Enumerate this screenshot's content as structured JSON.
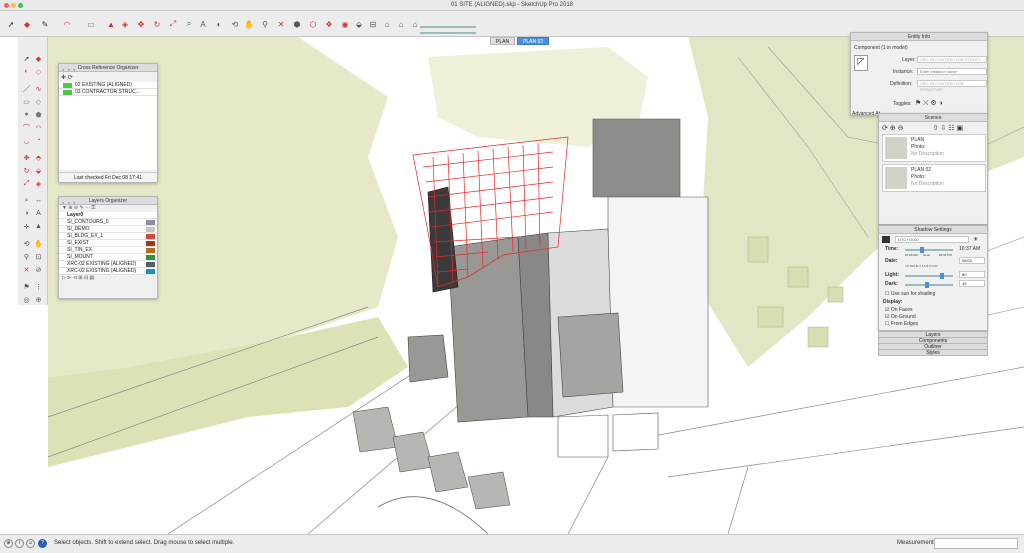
{
  "window": {
    "title": "01 SITE (ALIGNED).skp - SketchUp Pro 2018"
  },
  "colors": {
    "selection": "#e8272a",
    "terrain": "#dfe3b8",
    "building_dark": "#8a8886",
    "accent": "#4a90d9"
  },
  "scene_tabs": [
    {
      "label": "PLAN",
      "active": false
    },
    {
      "label": "PLAN 02",
      "active": true
    }
  ],
  "toolbar": {
    "shadow_time_start": "06:30",
    "shadow_time_end": "10:37 AM"
  },
  "xref_organizer": {
    "title": "Cross Reference Organizer",
    "items": [
      {
        "label": "02 EXISTING (ALIGNED)",
        "color": "#4fc84a"
      },
      {
        "label": "03 CONTRACTOR STRUC...",
        "color": "#4fc84a"
      }
    ],
    "footer": "Last checked Fri Dec 08 17:41"
  },
  "layers_organizer": {
    "title": "Layers Organizer",
    "header": "Layer0",
    "layers": [
      {
        "name": "SI_CONTOURS_0",
        "color": "#8a8f9c"
      },
      {
        "name": "SI_DEMO",
        "color": "#c6c6c6"
      },
      {
        "name": "SI_BLDG_EX_1",
        "color": "#d8453f"
      },
      {
        "name": "SI_EXIST",
        "color": "#9b3a2c"
      },
      {
        "name": "SI_TIN_EX",
        "color": "#b66a1a"
      },
      {
        "name": "SI_MOUNT",
        "color": "#2f8f3a"
      },
      {
        "name": "XRC-02 EXISTING (ALIGNED)",
        "color": "#555f6c"
      },
      {
        "name": "XRC-02 EXISTING (ALIGNED)",
        "color": "#1e91b6"
      }
    ]
  },
  "entity_info": {
    "title": "Entity Info",
    "component": "Component (1 in model)",
    "layer_label": "Layer:",
    "layer_value": "XRC-03 CONTRACTOR STRUCT",
    "instance_label": "Instance:",
    "instance_placeholder": "Enter instance name",
    "definition_label": "Definition:",
    "definition_value": "XRC-03 CONTRACTOR STRUCTUR",
    "toggles_label": "Toggles:",
    "advanced_label": "Advanced At"
  },
  "scenes": {
    "title": "Scenes",
    "items": [
      {
        "name": "PLAN",
        "photo": "Photo:",
        "desc": "No Description"
      },
      {
        "name": "PLAN 02",
        "photo": "Photo:",
        "desc": "No Description"
      }
    ]
  },
  "shadow_settings": {
    "title": "Shadow Settings",
    "utc": "UTC+10:00",
    "time_label": "Time:",
    "time_value": "10:37 AM",
    "time_start": "07:03 AM",
    "time_mid": "Noon",
    "time_end": "05:31 PM",
    "date_label": "Date:",
    "date_value": "08/20",
    "months": "J F M A M J J A S O N D",
    "light_label": "Light:",
    "light_value": "80",
    "dark_label": "Dark:",
    "dark_value": "45",
    "use_sun": "Use sun for shading",
    "display_label": "Display:",
    "on_faces": "On Faces",
    "on_ground": "On Ground",
    "from_edges": "From Edges",
    "time_level": 0.33,
    "light_level": 0.8,
    "dark_level": 0.45
  },
  "collapsed_trays": [
    "Layers",
    "Components",
    "Outliner",
    "Styles"
  ],
  "statusbar": {
    "message": "Select objects. Shift to extend select. Drag mouse to select multiple.",
    "measurements_label": "Measurements"
  }
}
